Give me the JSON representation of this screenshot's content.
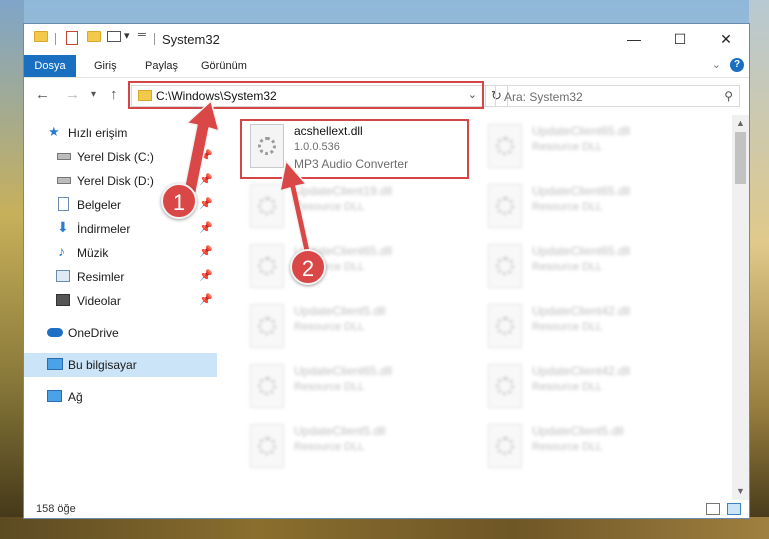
{
  "window": {
    "title": "System32",
    "controls": {
      "minimize": "—",
      "maximize": "☐",
      "close": "✕"
    }
  },
  "ribbon": {
    "tabs": [
      "Dosya",
      "Giriş",
      "Paylaş",
      "Görünüm"
    ],
    "help": "?"
  },
  "navigation": {
    "address": "C:\\Windows\\System32",
    "search_placeholder": "Ara: System32"
  },
  "sidebar": {
    "items": [
      {
        "label": "Hızlı erişim",
        "icon": "star-icon",
        "pinned": false
      },
      {
        "label": "Yerel Disk (C:)",
        "icon": "drive-icon",
        "pinned": true
      },
      {
        "label": "Yerel Disk (D:)",
        "icon": "drive-icon",
        "pinned": true
      },
      {
        "label": "Belgeler",
        "icon": "documents-icon",
        "pinned": true
      },
      {
        "label": "İndirmeler",
        "icon": "download-icon",
        "pinned": true
      },
      {
        "label": "Müzik",
        "icon": "music-icon",
        "pinned": true
      },
      {
        "label": "Resimler",
        "icon": "pictures-icon",
        "pinned": true
      },
      {
        "label": "Videolar",
        "icon": "video-icon",
        "pinned": true
      },
      {
        "label": "OneDrive",
        "icon": "cloud-icon",
        "pinned": false
      },
      {
        "label": "Bu bilgisayar",
        "icon": "computer-icon",
        "pinned": false,
        "selected": true
      },
      {
        "label": "Ağ",
        "icon": "network-icon",
        "pinned": false
      }
    ]
  },
  "files": [
    {
      "name": "acshellext.dll",
      "version": "1.0.0.536",
      "description": "MP3 Audio Converter",
      "highlighted": true
    },
    {
      "name": "UpdateClient65.dll",
      "version": "Resource DLL"
    },
    {
      "name": "UpdateClient19.dll",
      "version": "Resource DLL"
    },
    {
      "name": "UpdateClient65.dll",
      "version": "Resource DLL"
    },
    {
      "name": "UpdateClient65.dll",
      "version": "Resource DLL"
    },
    {
      "name": "UpdateClient65.dll",
      "version": "Resource DLL"
    },
    {
      "name": "UpdateClient5.dll",
      "version": "Resource DLL"
    },
    {
      "name": "UpdateClient42.dll",
      "version": "Resource DLL"
    },
    {
      "name": "UpdateClient65.dll",
      "version": "Resource DLL"
    },
    {
      "name": "UpdateClient42.dll",
      "version": "Resource DLL"
    },
    {
      "name": "UpdateClient5.dll",
      "version": "Resource DLL"
    },
    {
      "name": "UpdateClient5.dll",
      "version": "Resource DLL"
    }
  ],
  "status": {
    "count": "158 öğe"
  },
  "annotations": {
    "step1": "1",
    "step2": "2",
    "color": "#d94747"
  }
}
